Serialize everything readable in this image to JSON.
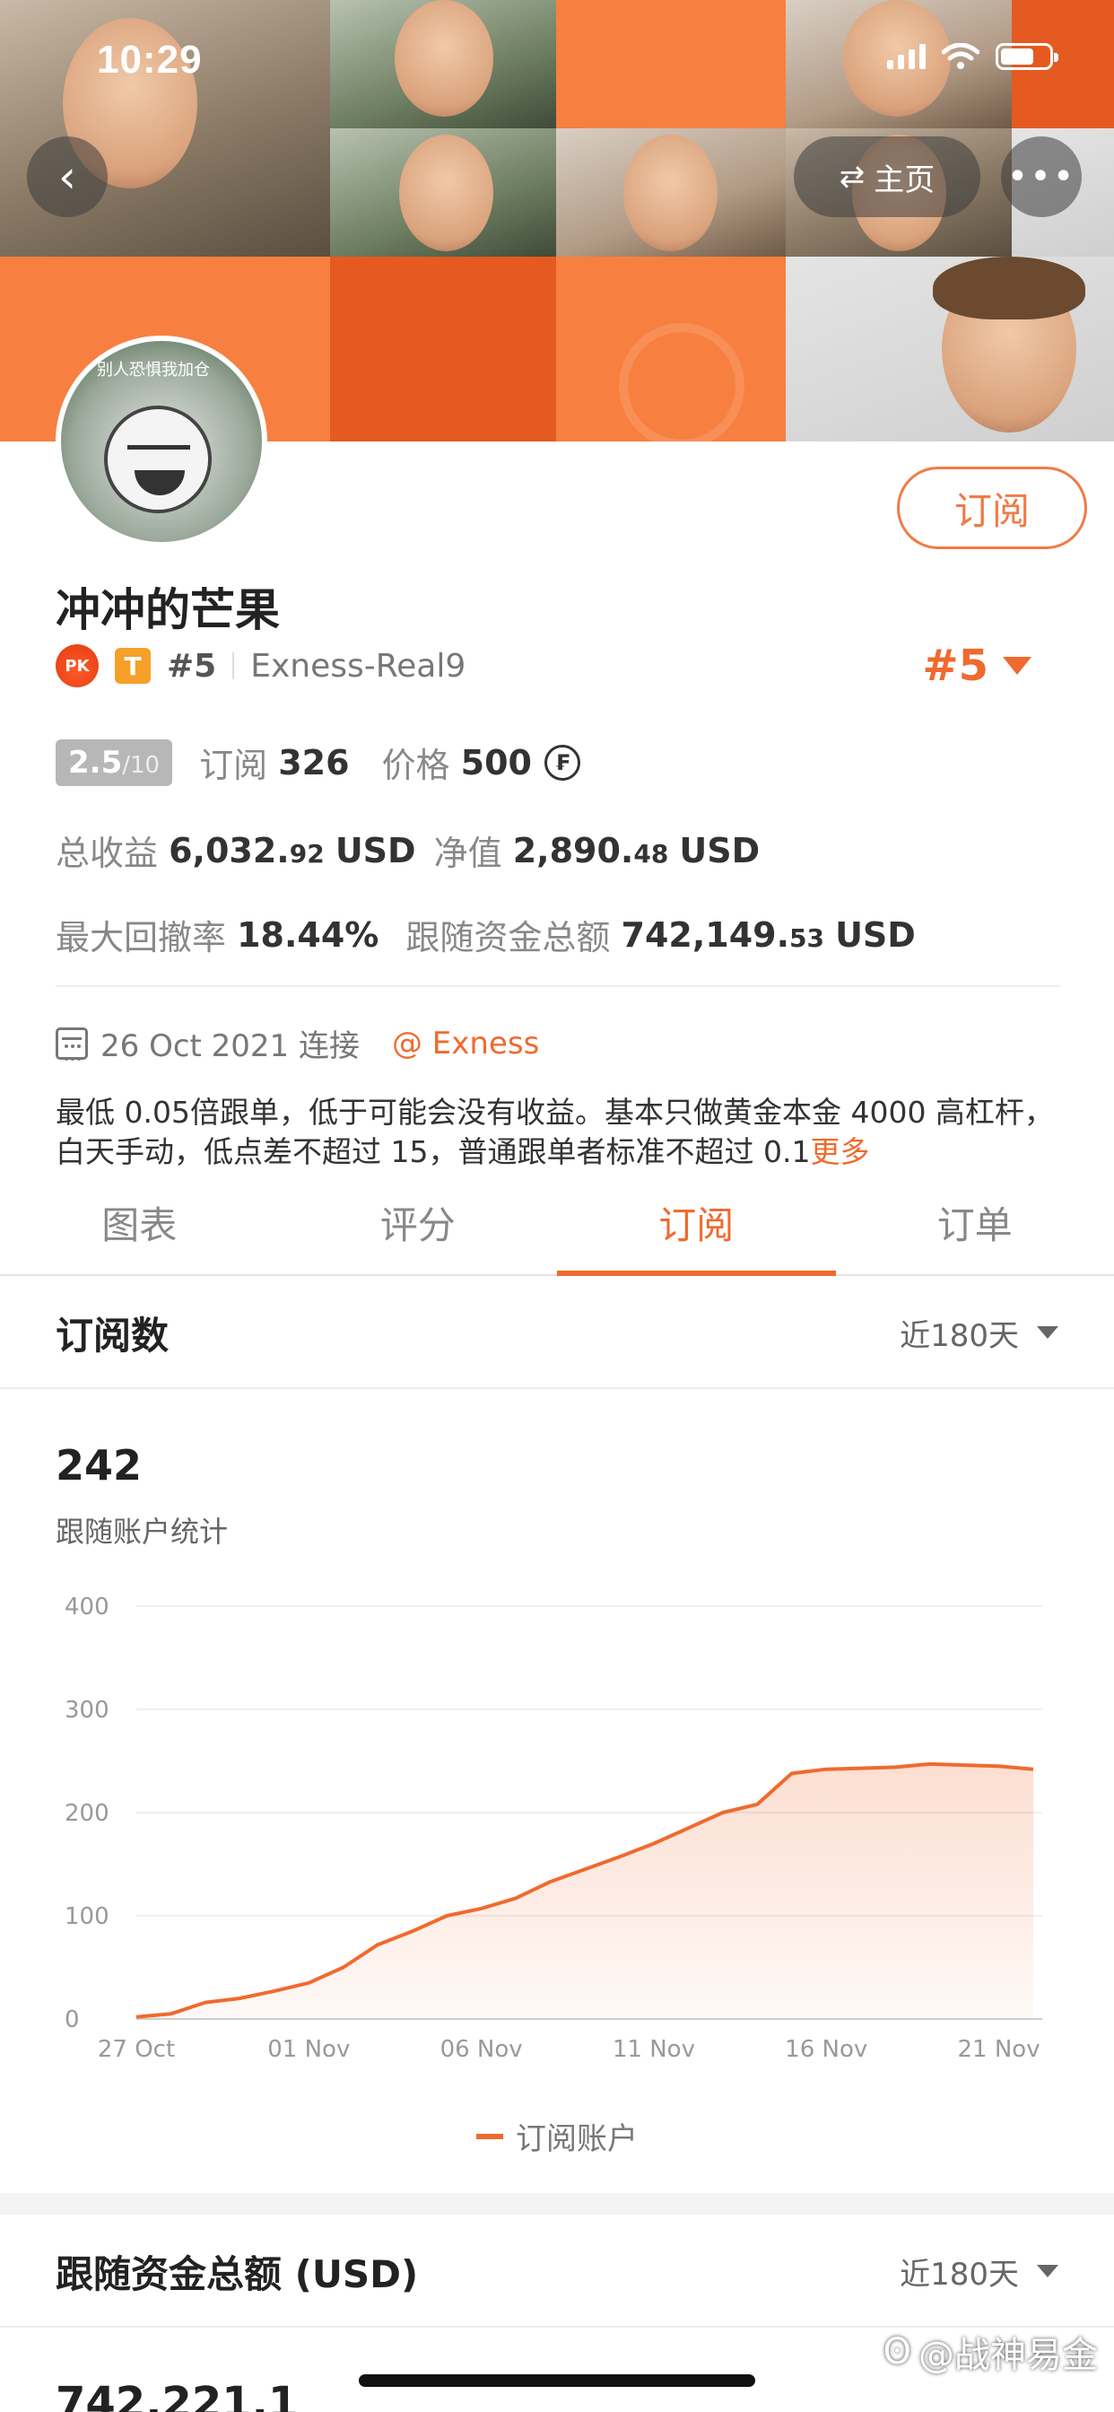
{
  "status_bar": {
    "time": "10:29"
  },
  "nav": {
    "back_icon": "chevron-left-icon",
    "home_label": "主页",
    "home_icon": "swap-icon",
    "more_icon": "ellipsis-icon"
  },
  "profile": {
    "name": "冲冲的芒果",
    "pk_label": "PK",
    "tier_label": "T",
    "rank_small": "#5",
    "account": "Exness-Real9",
    "rank_big": "#5",
    "subscribe_button": "订阅",
    "avatar_text": "别人恐惧我加仓"
  },
  "stats": {
    "score": "2.5",
    "score_max": "/10",
    "subscriptions_label": "订阅",
    "subscriptions_value": "326",
    "price_label": "价格",
    "price_value": "500",
    "coin_icon": "currency-coin-icon",
    "total_profit_label": "总收益",
    "total_profit_int": "6,032.",
    "total_profit_dec": "92",
    "total_profit_unit": "USD",
    "equity_label": "净值",
    "equity_int": "2,890.",
    "equity_dec": "48",
    "equity_unit": "USD",
    "max_drawdown_label": "最大回撤率",
    "max_drawdown_value": "18.44%",
    "follow_funds_label": "跟随资金总额",
    "follow_funds_int": "742,149.",
    "follow_funds_dec": "53",
    "follow_funds_unit": "USD"
  },
  "meta": {
    "connected_date": "26 Oct 2021 连接",
    "broker": "@ Exness"
  },
  "description": {
    "text": "最低 0.05倍跟单，低于可能会没有收益。基本只做黄金本金 4000 高杠杆，白天手动，低点差不超过 15，普通跟单者标准不超过 0.1",
    "more": "更多"
  },
  "tabs": [
    {
      "label": "图表",
      "active": false
    },
    {
      "label": "评分",
      "active": false
    },
    {
      "label": "订阅",
      "active": true
    },
    {
      "label": "订单",
      "active": false
    }
  ],
  "subscriptions_section": {
    "title": "订阅数",
    "range": "近180天",
    "count": "242",
    "subtitle": "跟随账户统计",
    "legend": "订阅账户"
  },
  "funds_section": {
    "title": "跟随资金总额 (USD)",
    "range": "近180天",
    "partial_value": "742,221.1"
  },
  "watermark": "@战神易金",
  "colors": {
    "accent": "#f06a2e",
    "banner": "#f2662a"
  },
  "chart_data": {
    "type": "area",
    "x": [
      "27 Oct",
      "28 Oct",
      "29 Oct",
      "30 Oct",
      "31 Oct",
      "01 Nov",
      "02 Nov",
      "03 Nov",
      "04 Nov",
      "05 Nov",
      "06 Nov",
      "07 Nov",
      "08 Nov",
      "09 Nov",
      "10 Nov",
      "11 Nov",
      "12 Nov",
      "13 Nov",
      "14 Nov",
      "15 Nov",
      "16 Nov",
      "17 Nov",
      "18 Nov",
      "19 Nov",
      "20 Nov",
      "21 Nov",
      "22 Nov"
    ],
    "series": [
      {
        "name": "订阅账户",
        "values": [
          2,
          5,
          16,
          20,
          27,
          35,
          50,
          72,
          85,
          100,
          107,
          117,
          133,
          145,
          157,
          170,
          185,
          200,
          208,
          238,
          242,
          243,
          244,
          247,
          246,
          245,
          242
        ]
      }
    ],
    "x_ticks": [
      "27 Oct",
      "01 Nov",
      "06 Nov",
      "11 Nov",
      "16 Nov",
      "21 Nov"
    ],
    "y_ticks": [
      0,
      100,
      200,
      300,
      400
    ],
    "ylim": [
      0,
      400
    ],
    "grid": true,
    "legend_position": "bottom",
    "color": "#f06a2e"
  }
}
